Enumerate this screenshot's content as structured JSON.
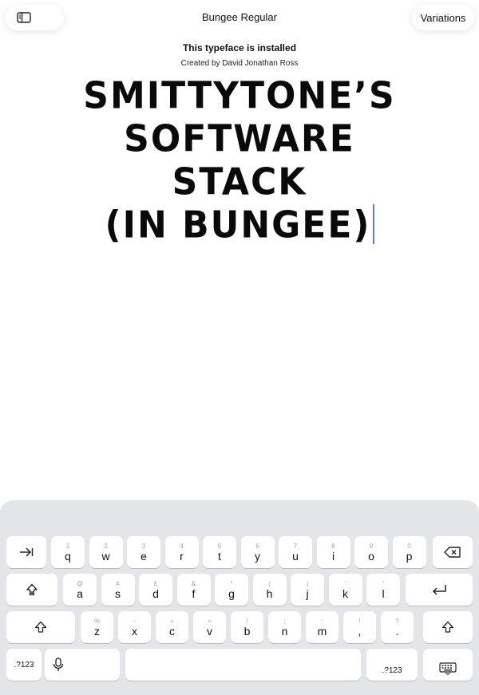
{
  "header": {
    "title": "Bungee Regular",
    "variations_label": "Variations",
    "sidebar_icon": "sidebar-icon"
  },
  "info": {
    "status": "This typeface is installed",
    "credit": "Created by David Jonathan Ross"
  },
  "preview": {
    "lines": [
      "SMITTYTONE’S",
      "SOFTWARE",
      "STACK",
      "(IN BUNGEE)"
    ]
  },
  "keyboard": {
    "row1": [
      {
        "hint": "1",
        "label": "q"
      },
      {
        "hint": "2",
        "label": "w"
      },
      {
        "hint": "3",
        "label": "e"
      },
      {
        "hint": "4",
        "label": "r"
      },
      {
        "hint": "5",
        "label": "t"
      },
      {
        "hint": "6",
        "label": "y"
      },
      {
        "hint": "7",
        "label": "u"
      },
      {
        "hint": "8",
        "label": "i"
      },
      {
        "hint": "9",
        "label": "o"
      },
      {
        "hint": "0",
        "label": "p"
      }
    ],
    "row2": [
      {
        "hint": "@",
        "label": "a"
      },
      {
        "hint": "#",
        "label": "s"
      },
      {
        "hint": "£",
        "label": "d"
      },
      {
        "hint": "&",
        "label": "f"
      },
      {
        "hint": "*",
        "label": "g"
      },
      {
        "hint": "(",
        "label": "h"
      },
      {
        "hint": ")",
        "label": "j"
      },
      {
        "hint": "’",
        "label": "k"
      },
      {
        "hint": "\"",
        "label": "l"
      }
    ],
    "row3": [
      {
        "hint": "%",
        "label": "z"
      },
      {
        "hint": "-",
        "label": "x"
      },
      {
        "hint": "+",
        "label": "c"
      },
      {
        "hint": "=",
        "label": "v"
      },
      {
        "hint": "/",
        "label": "b"
      },
      {
        "hint": ";",
        "label": "n"
      },
      {
        "hint": ":",
        "label": "m"
      },
      {
        "hint": "!",
        "label": ","
      },
      {
        "hint": "?",
        "label": "."
      }
    ],
    "numbers_label": ".?123",
    "numbers_label_right": ".?123"
  }
}
